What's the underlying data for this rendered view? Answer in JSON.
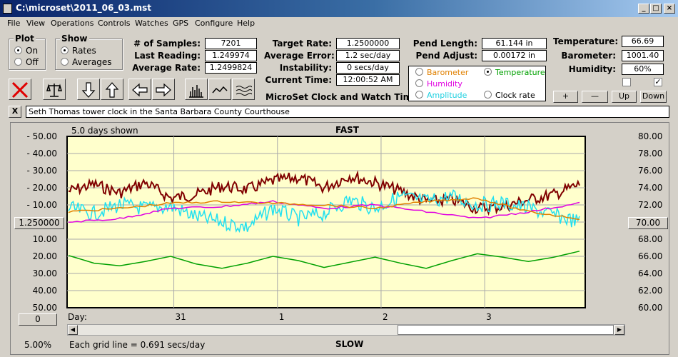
{
  "window": {
    "title": "C:\\microset\\2011_06_03.mst"
  },
  "menu": [
    "File",
    "View",
    "Operations",
    "Controls",
    "Watches",
    "GPS",
    "Configure",
    "Help"
  ],
  "plot_group": {
    "caption": "Plot",
    "on": "On",
    "off": "Off",
    "selected": "On"
  },
  "show_group": {
    "caption": "Show",
    "rates": "Rates",
    "averages": "Averages",
    "selected": "Rates"
  },
  "stats": {
    "samples_label": "# of Samples:",
    "samples": "7201",
    "last_label": "Last Reading:",
    "last": "1.249974",
    "avg_rate_label": "Average Rate:",
    "avg_rate": "1.2499824",
    "target_label": "Target Rate:",
    "target": "1.2500000",
    "avg_error_label": "Average Error:",
    "avg_error": "1.2 sec/day",
    "instability_label": "Instability:",
    "instability": "0 secs/day",
    "time_label": "Current Time:",
    "time": "12:00:52 AM",
    "pend_len_label": "Pend Length:",
    "pend_len": "61.144 in",
    "pend_adj_label": "Pend Adjust:",
    "pend_adj": "0.00172 in",
    "temp_label": "Temperature:",
    "temp": "66.69",
    "baro_label": "Barometer:",
    "baro": "1001.40",
    "hum_label": "Humidity:",
    "hum": "60%"
  },
  "app_title": "MicroSet Clock and Watch Timer",
  "sensor_select": {
    "barometer": "Barometer",
    "temperature": "Temperature",
    "humidity": "Humidity",
    "amplitude": "Amplitude",
    "clock_rate": "Clock rate",
    "selected": "Temperature"
  },
  "sensor_buttons": {
    "plus": "+",
    "minus": "—",
    "up": "Up",
    "down": "Down"
  },
  "description": "Seth Thomas tower clock in the Santa Barbara County Courthouse",
  "close_btn": "X",
  "chart_labels": {
    "days_shown": "5.0 days shown",
    "top": "FAST",
    "bottom": "SLOW",
    "center_value": "1.250000",
    "right_center": "70.00",
    "left_bottom_box": "0",
    "scale_pct": "5.00%",
    "grid_note": "Each grid line = 0.691 secs/day",
    "day_label": "Day:"
  },
  "colors": {
    "rate": "#800000",
    "temperature": "#00a000",
    "humidity": "#e000e0",
    "amplitude": "#20e0f0",
    "barometer": "#e08000",
    "plot_bg": "#ffffcc"
  },
  "chart_data": {
    "type": "line",
    "left_ticks": [
      "- 50.00",
      "- 40.00",
      "- 30.00",
      "- 20.00",
      "- 10.00",
      "10.00",
      "20.00",
      "30.00",
      "40.00",
      "50.00"
    ],
    "right_ticks": [
      "80.00",
      "78.00",
      "76.00",
      "74.00",
      "72.00",
      "68.00",
      "66.00",
      "64.00",
      "62.00",
      "60.00"
    ],
    "x_ticks": [
      "31",
      "1",
      "2",
      "3"
    ],
    "x_range_days": 5.0,
    "temperature_range": [
      60,
      80
    ],
    "series": [
      {
        "name": "Rate",
        "color": "#800000",
        "x": [
          0,
          0.25,
          0.5,
          0.75,
          1,
          1.25,
          1.5,
          1.75,
          2,
          2.25,
          2.5,
          2.75,
          3,
          3.25,
          3.5,
          3.75,
          4,
          4.25,
          4.5,
          4.75,
          5
        ],
        "values": [
          -18,
          -22,
          -17,
          -23,
          -14,
          -16,
          -21,
          -19,
          -24,
          -26,
          -20,
          -27,
          -23,
          -18,
          -12,
          -13,
          -8,
          -9,
          -13,
          -16,
          -22
        ]
      },
      {
        "name": "Amplitude",
        "color": "#20e0f0",
        "x": [
          0,
          0.25,
          0.5,
          0.75,
          1,
          1.25,
          1.5,
          1.75,
          2,
          2.25,
          2.5,
          2.75,
          3,
          3.25,
          3.5,
          3.75,
          4,
          4.25,
          4.5,
          4.75,
          5
        ],
        "values": [
          -8,
          -5,
          -10,
          -8,
          -9,
          -3,
          0,
          3,
          -8,
          -2,
          -5,
          -13,
          -8,
          -15,
          -12,
          -15,
          -10,
          -11,
          -8,
          -4,
          0
        ]
      },
      {
        "name": "Humidity",
        "color": "#e000e0",
        "x": [
          0,
          0.5,
          1,
          1.5,
          2,
          2.5,
          3,
          3.5,
          4,
          4.5,
          5
        ],
        "values": [
          0,
          -2,
          -8,
          -9,
          -12,
          -8,
          -10,
          -6,
          -2,
          -6,
          -11
        ]
      },
      {
        "name": "Barometer",
        "color": "#e08000",
        "x": [
          0,
          0.5,
          1,
          1.5,
          2,
          2.5,
          3,
          3.5,
          4,
          4.5,
          5
        ],
        "values": [
          -6,
          -8,
          -11,
          -12,
          -11,
          -10,
          -8,
          -12,
          -14,
          -6,
          -2
        ]
      },
      {
        "name": "Temperature",
        "color": "#00a000",
        "x": [
          0,
          0.25,
          0.5,
          0.75,
          1,
          1.25,
          1.5,
          1.75,
          2,
          2.25,
          2.5,
          2.75,
          3,
          3.25,
          3.5,
          3.75,
          4,
          4.25,
          4.5,
          4.75,
          5
        ],
        "values": [
          66.1,
          65.2,
          64.9,
          65.4,
          66.0,
          65.1,
          64.6,
          65.2,
          66.0,
          65.5,
          64.7,
          65.3,
          65.9,
          65.2,
          64.6,
          65.5,
          66.3,
          65.9,
          65.4,
          65.9,
          66.6
        ]
      }
    ]
  }
}
